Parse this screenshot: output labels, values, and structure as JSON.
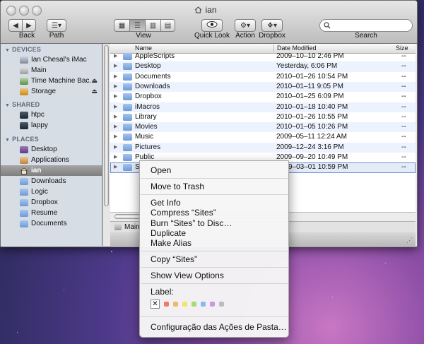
{
  "window": {
    "title": "ian"
  },
  "toolbar": {
    "back_label": "Back",
    "path_label": "Path",
    "view_label": "View",
    "quicklook_label": "Quick Look",
    "action_label": "Action",
    "dropbox_label": "Dropbox",
    "search_label": "Search",
    "search_placeholder": ""
  },
  "sidebar": {
    "devices_heading": "DEVICES",
    "devices": [
      "Ian Chesal's iMac",
      "Main",
      "Time Machine Bac...",
      "Storage"
    ],
    "shared_heading": "SHARED",
    "shared": [
      "htpc",
      "lappy"
    ],
    "places_heading": "PLACES",
    "places": [
      "Desktop",
      "Applications",
      "ian",
      "Downloads",
      "Logic",
      "Dropbox",
      "Resume",
      "Documents"
    ]
  },
  "list": {
    "columns": {
      "name": "Name",
      "date": "Date Modified",
      "size": "Size"
    },
    "rows": [
      {
        "name": "AppleScripts",
        "date": "2009–10–10 2:46 PM",
        "size": "--"
      },
      {
        "name": "Desktop",
        "date": "Yesterday, 6:06 PM",
        "size": "--"
      },
      {
        "name": "Documents",
        "date": "2010–01–26 10:54 PM",
        "size": "--"
      },
      {
        "name": "Downloads",
        "date": "2010–01–11 9:05 PM",
        "size": "--"
      },
      {
        "name": "Dropbox",
        "date": "2010–01–25 6:09 PM",
        "size": "--"
      },
      {
        "name": "iMacros",
        "date": "2010–01–18 10:40 PM",
        "size": "--"
      },
      {
        "name": "Library",
        "date": "2010–01–26 10:55 PM",
        "size": "--"
      },
      {
        "name": "Movies",
        "date": "2010–01–05 10:26 PM",
        "size": "--"
      },
      {
        "name": "Music",
        "date": "2009–05–11 12:24 AM",
        "size": "--"
      },
      {
        "name": "Pictures",
        "date": "2009–12–24 3:16 PM",
        "size": "--"
      },
      {
        "name": "Public",
        "date": "2009–09–20 10:49 PM",
        "size": "--"
      },
      {
        "name": "Si",
        "date": "9–03–01 10:59 PM",
        "size": "--"
      }
    ]
  },
  "pathbar": {
    "item": "Main"
  },
  "context_menu": {
    "open": "Open",
    "move_to_trash": "Move to Trash",
    "get_info": "Get Info",
    "compress": "Compress “Sites”",
    "burn": "Burn “Sites” to Disc…",
    "duplicate": "Duplicate",
    "make_alias": "Make Alias",
    "copy": "Copy “Sites”",
    "show_view_options": "Show View Options",
    "label_heading": "Label:",
    "label_clear": "✕",
    "label_colors": [
      "#f07a6a",
      "#f5b56a",
      "#f2e46a",
      "#a6dc72",
      "#8bb8f2",
      "#c69ae6",
      "#bdbdbd"
    ],
    "folder_actions": "Configuração das Ações de Pasta…"
  }
}
